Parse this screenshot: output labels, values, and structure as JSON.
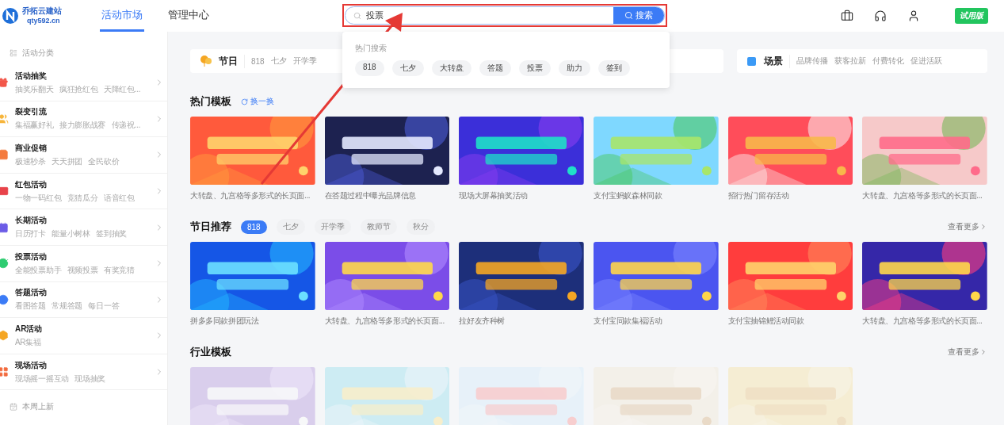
{
  "header": {
    "logo": {
      "name": "乔拓云建站",
      "domain": "qty592.cn"
    },
    "nav": [
      {
        "label": "活动市场",
        "selected": true
      },
      {
        "label": "管理中心",
        "selected": false
      }
    ],
    "search": {
      "value": "投票",
      "button": "搜索"
    },
    "trial_badge": "试用版"
  },
  "search_dropdown": {
    "title": "热门搜索",
    "chips": [
      "818",
      "七夕",
      "大转盘",
      "答题",
      "投票",
      "助力",
      "签到"
    ]
  },
  "sidebar": {
    "category_title": "活动分类",
    "items": [
      {
        "title": "活动抽奖",
        "subtitle": "抽奖乐翻天   疯狂抢红包   天降红包...",
        "color": "#f2574a"
      },
      {
        "title": "裂变引流",
        "subtitle": "集福赢好礼   接力膨胀战赛   传递祝...",
        "color": "#f7b53a"
      },
      {
        "title": "商业促销",
        "subtitle": "极速秒杀   天天拼团   全民砍价",
        "color": "#f47b3e"
      },
      {
        "title": "红包活动",
        "subtitle": "一物一码红包   竞猜瓜分   语音红包",
        "color": "#e8434a"
      },
      {
        "title": "长期活动",
        "subtitle": "日历打卡   能量小树林   签到抽奖",
        "color": "#6c5ce7"
      },
      {
        "title": "投票活动",
        "subtitle": "全能投票助手   视频投票   有奖竞猜",
        "color": "#2ecc71"
      },
      {
        "title": "答题活动",
        "subtitle": "看图答题   常规答题   每日一答",
        "color": "#3b7bf6"
      },
      {
        "title": "AR活动",
        "subtitle": "AR集福",
        "color": "#f5a623"
      },
      {
        "title": "现场活动",
        "subtitle": "现场摇一摇互动   现场抽奖",
        "color": "#f26a3d"
      }
    ],
    "new_title": "本周上新"
  },
  "filters": [
    {
      "kind": "holiday",
      "title": "节日",
      "tags": [
        "818",
        "七夕",
        "开学季"
      ]
    },
    {
      "kind": "scene",
      "title": "场景",
      "tags": [
        "品牌传播",
        "获客拉新",
        "付费转化",
        "促进活跃"
      ]
    }
  ],
  "sections": [
    {
      "title": "热门模板",
      "action": "换一换",
      "faded": false,
      "cards": [
        {
          "kind": "picture",
          "caption": "大转盘、九宫格等多形式的长页面..."
        },
        {
          "kind": "picture",
          "caption": "在答题过程中曝光品牌信息"
        },
        {
          "kind": "picture",
          "caption": "现场大屏幕抽奖活动"
        },
        {
          "kind": "picture",
          "caption": "支付宝蚂蚁森林同款"
        },
        {
          "kind": "picture",
          "caption": "招行热门留存活动"
        },
        {
          "kind": "picture",
          "caption": "大转盘、九宫格等多形式的长页面..."
        }
      ]
    },
    {
      "title": "节日推荐",
      "more": "查看更多",
      "faded": false,
      "pills": [
        {
          "label": "818",
          "selected": true
        },
        {
          "label": "七夕",
          "selected": false
        },
        {
          "label": "开学季",
          "selected": false
        },
        {
          "label": "教师节",
          "selected": false
        },
        {
          "label": "秋分",
          "selected": false
        }
      ],
      "cards": [
        {
          "kind": "picture",
          "caption": "拼多多同款拼团玩法"
        },
        {
          "kind": "picture",
          "caption": "大转盘、九宫格等多形式的长页面..."
        },
        {
          "kind": "picture",
          "caption": "拉好友齐种树"
        },
        {
          "kind": "picture",
          "caption": "支付宝同款集福活动"
        },
        {
          "kind": "picture",
          "caption": "支付宝抽锦鲤活动同款"
        },
        {
          "kind": "picture",
          "caption": "大转盘、九宫格等多形式的长页面..."
        }
      ]
    },
    {
      "title": "行业模板",
      "more": "查看更多",
      "faded": true
    }
  ]
}
